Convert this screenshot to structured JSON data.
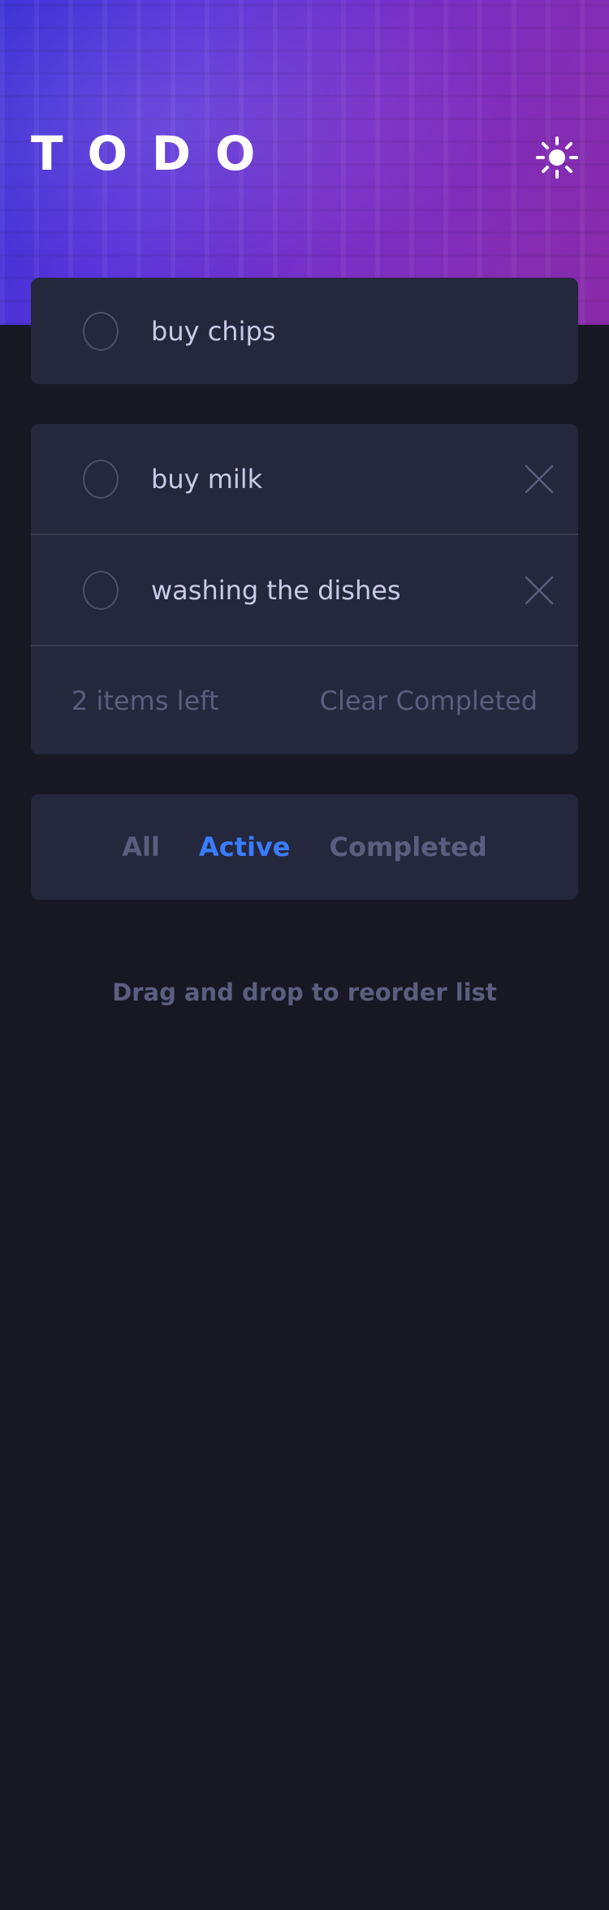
{
  "app": {
    "title": "TODO",
    "theme_icon": "sun-icon"
  },
  "new_todo": {
    "value": "buy chips"
  },
  "todos": [
    {
      "text": "buy milk",
      "completed": false
    },
    {
      "text": "washing the dishes",
      "completed": false
    }
  ],
  "footer": {
    "items_left": "2 items left",
    "clear_label": "Clear Completed"
  },
  "filters": {
    "all": "All",
    "active": "Active",
    "completed": "Completed",
    "selected": "Active"
  },
  "hint": "Drag and drop to reorder list",
  "colors": {
    "background": "#171823",
    "card": "#25273d",
    "text": "#c8cbe7",
    "muted": "#5b5e7e",
    "accent": "#3a7cfd",
    "hero_start": "#3a2fd6",
    "hero_end": "#8a2aa8"
  }
}
